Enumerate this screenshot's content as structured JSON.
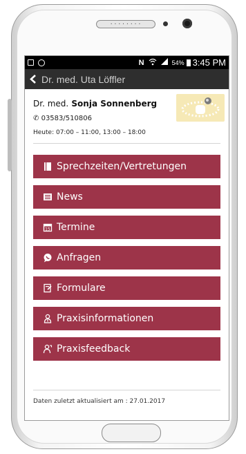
{
  "statusbar": {
    "battery": "54%",
    "time": "3:45 PM",
    "icons": [
      "image-icon",
      "instagram-icon",
      "nfc-icon",
      "wifi-icon",
      "signal-icon",
      "battery-icon"
    ]
  },
  "toolbar": {
    "title": "Dr. med. Uta Löffler"
  },
  "doctor": {
    "prefix": "Dr. med.",
    "name": "Sonja Sonnenberg",
    "phone": "03583/510806",
    "hours": "Heute: 07:00 – 11:00, 13:00 – 18:00"
  },
  "menu": [
    {
      "label": "Sprechzeiten/Vertretungen",
      "icon": "book-icon"
    },
    {
      "label": "News",
      "icon": "newspaper-icon"
    },
    {
      "label": "Termine",
      "icon": "calendar-icon"
    },
    {
      "label": "Anfragen",
      "icon": "chat-icon"
    },
    {
      "label": "Formulare",
      "icon": "form-icon"
    },
    {
      "label": "Praxisinformationen",
      "icon": "doctor-icon"
    },
    {
      "label": "Praxisfeedback",
      "icon": "feedback-icon"
    }
  ],
  "footer": {
    "text": "Daten zuletzt aktualisiert am : 27.01.2017"
  },
  "colors": {
    "accent": "#9d3449",
    "toolbar": "#2e2e2e",
    "statusbar": "#000000"
  }
}
